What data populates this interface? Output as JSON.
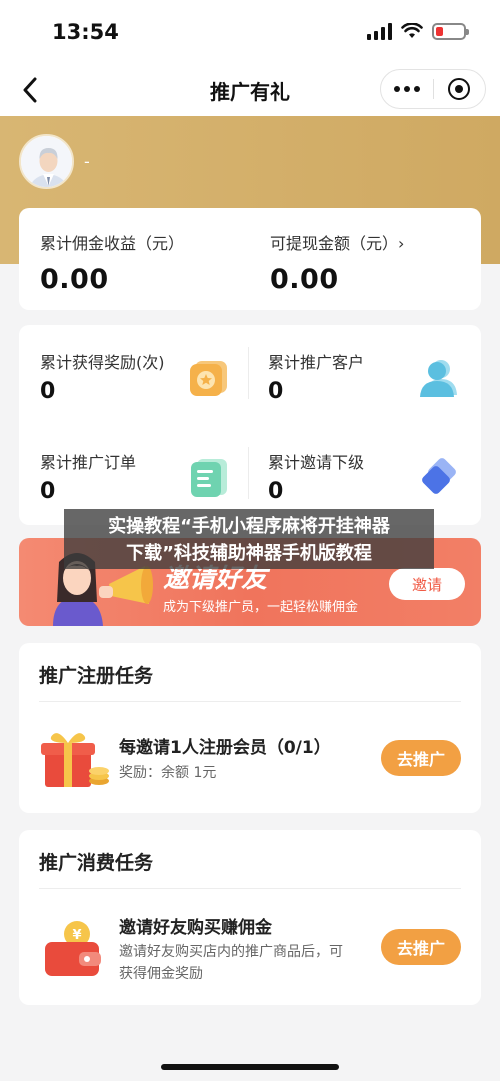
{
  "status_bar": {
    "time": "13:54"
  },
  "nav": {
    "title": "推广有礼"
  },
  "user": {
    "name": "-"
  },
  "earnings": {
    "total_label": "累计佣金收益（元）",
    "total_value": "0.00",
    "withdrawable_label": "可提现金额（元）›",
    "withdrawable_value": "0.00"
  },
  "stats": [
    {
      "label": "累计获得奖励(次)",
      "value": "0"
    },
    {
      "label": "累计推广客户",
      "value": "0"
    },
    {
      "label": "累计推广订单",
      "value": "0"
    },
    {
      "label": "累计邀请下级",
      "value": "0"
    }
  ],
  "overlay": {
    "line1": "实操教程“手机小程序麻将开挂神器",
    "line2": "下载”科技辅助神器手机版教程"
  },
  "invite_banner": {
    "title": "邀请好友",
    "subtitle": "成为下级推广员，一起轻松赚佣金",
    "button": "邀请"
  },
  "register_task": {
    "header": "推广注册任务",
    "title": "每邀请1人注册会员（0/1）",
    "desc": "奖励：余额 1元",
    "button": "去推广"
  },
  "consume_task": {
    "header": "推广消费任务",
    "title": "邀请好友购买赚佣金",
    "desc_line1": "邀请好友购买店内的推广商品后，可",
    "desc_line2": "获得佣金奖励",
    "button": "去推广"
  },
  "colors": {
    "banner_gold": "#d8b673",
    "invite_red": "#f0745c",
    "task_button": "#f2a043"
  },
  "icons": [
    "back-arrow-icon",
    "more-dots-icon",
    "close-target-icon",
    "reward-coin-icon",
    "customer-person-icon",
    "order-list-icon",
    "subordinate-diamond-icon",
    "gift-box-icon",
    "wallet-coin-icon"
  ]
}
